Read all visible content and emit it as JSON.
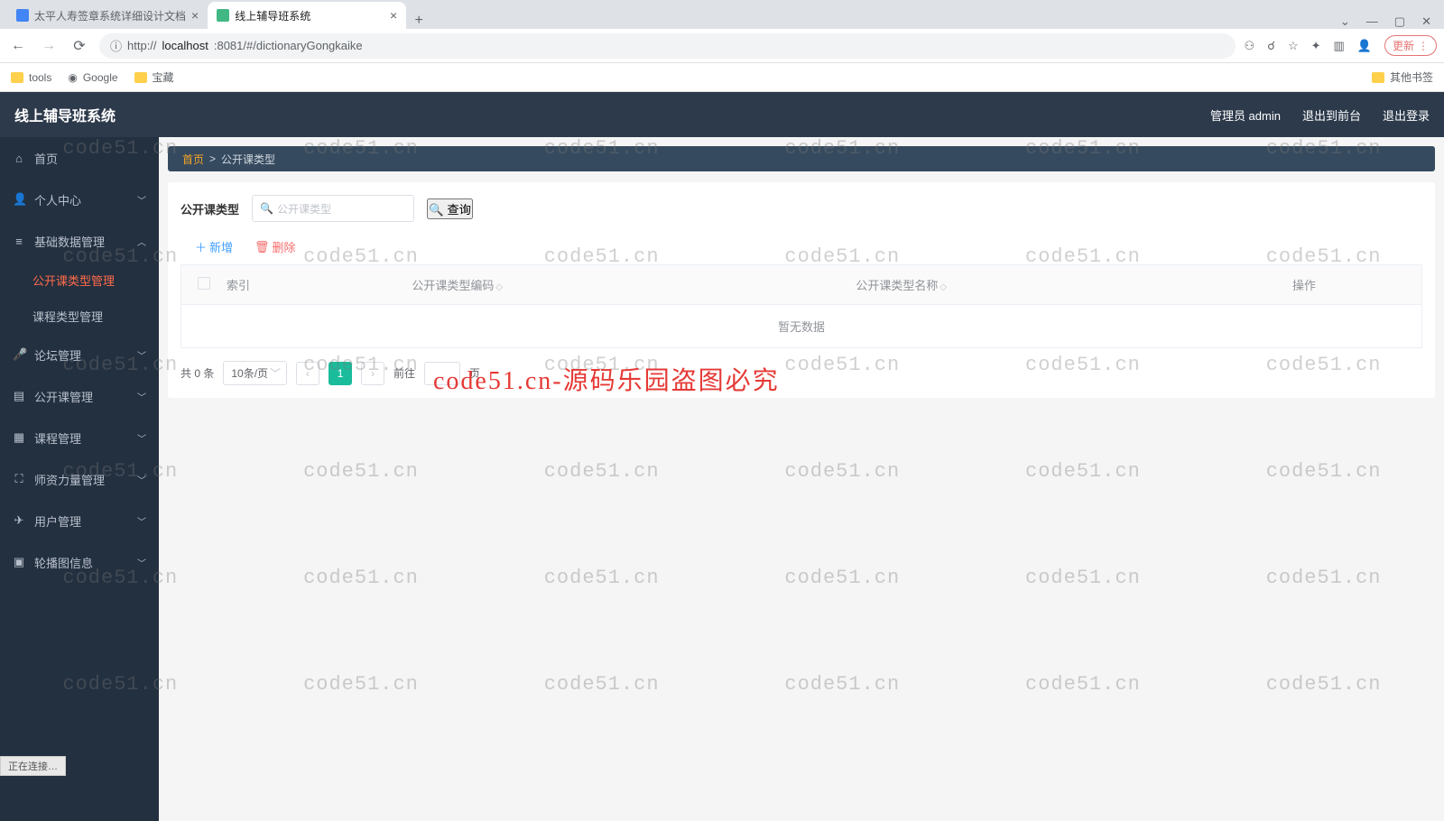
{
  "browser": {
    "tabs": [
      {
        "title": "太平人寿签章系统详细设计文档"
      },
      {
        "title": "线上辅导班系统"
      }
    ],
    "url_prefix": "http://",
    "url_host": "localhost",
    "url_rest": ":8081/#/dictionaryGongkaike",
    "update": "更新",
    "bookmarks": {
      "tools": "tools",
      "google": "Google",
      "treasure": "宝藏",
      "other": "其他书签"
    },
    "window": {
      "min": "—",
      "max": "▢",
      "close": "✕",
      "drop": "⌄"
    }
  },
  "header": {
    "title": "线上辅导班系统",
    "admin": "管理员 admin",
    "front": "退出到前台",
    "logout": "退出登录"
  },
  "sidebar": {
    "home": "首页",
    "personal": "个人中心",
    "basedata": "基础数据管理",
    "sub_gkk": "公开课类型管理",
    "sub_course": "课程类型管理",
    "forum": "论坛管理",
    "open_course": "公开课管理",
    "course": "课程管理",
    "teacher": "师资力量管理",
    "user": "用户管理",
    "carousel": "轮播图信息"
  },
  "breadcrumb": {
    "home": "首页",
    "sep": ">",
    "current": "公开课类型"
  },
  "search": {
    "label": "公开课类型",
    "placeholder": "公开课类型",
    "query": "查询"
  },
  "actions": {
    "add": "新增",
    "del": "删除"
  },
  "table": {
    "idx": "索引",
    "code": "公开课类型编码",
    "name": "公开课类型名称",
    "op": "操作",
    "empty": "暂无数据"
  },
  "pagination": {
    "total": "共 0 条",
    "per_page": "10条/页",
    "page1": "1",
    "goto": "前往",
    "page_suffix": "页"
  },
  "watermark": "code51.cn",
  "big_watermark": "code51.cn-源码乐园盗图必究",
  "status": "正在连接…"
}
